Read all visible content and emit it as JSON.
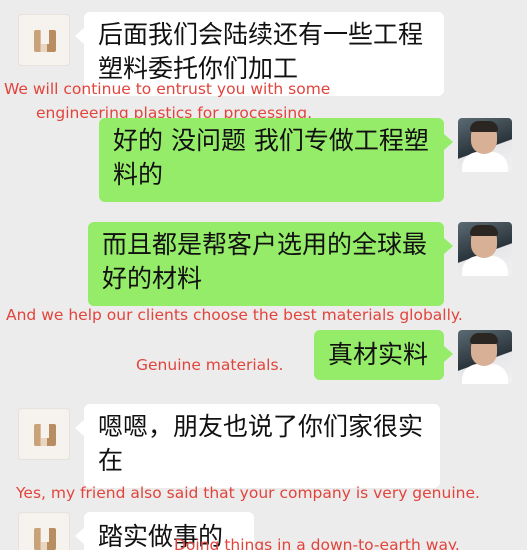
{
  "messages": [
    {
      "sender": "partner",
      "text": "后面我们会陆续还有一些工程\n塑料委托你们加工"
    },
    {
      "sender": "me",
      "text": "好的 没问题 我们专做工程塑\n料的"
    },
    {
      "sender": "me",
      "text": "而且都是帮客户选用的全球最\n好的材料"
    },
    {
      "sender": "me",
      "text": "真材实料"
    },
    {
      "sender": "partner",
      "text": "嗯嗯，朋友也说了你们家很实\n在"
    },
    {
      "sender": "partner",
      "text": "踏实做事的"
    }
  ],
  "translations": {
    "t1_line1": "We will continue to entrust you with some",
    "t1_line2": "engineering plastics for processing.",
    "t2": "And we help our clients choose the best materials globally.",
    "t3": "Genuine materials.",
    "t4": "Yes, my friend also said that your company is very genuine.",
    "t5_partial": "Doing things in a down-to-earth way."
  },
  "colors": {
    "background": "#ececec",
    "incoming_bubble": "#ffffff",
    "outgoing_bubble": "#95ec69",
    "translation_text": "#e2443c"
  }
}
